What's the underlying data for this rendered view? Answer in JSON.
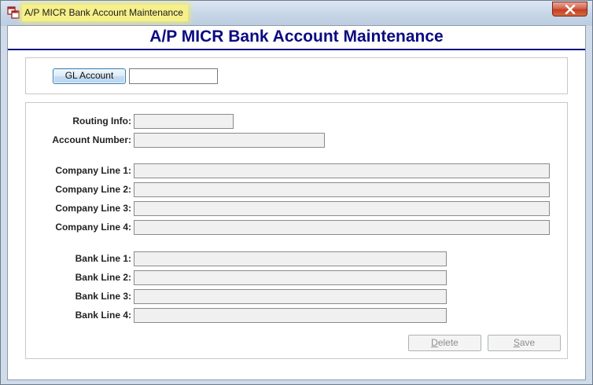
{
  "window": {
    "title": "A/P MICR Bank Account Maintenance",
    "icon": "app-window-icon",
    "close_icon": "close-icon"
  },
  "header": {
    "title": "A/P MICR Bank Account Maintenance"
  },
  "gl": {
    "button_label": "GL Account",
    "value": ""
  },
  "form": {
    "routing_label": "Routing Info:",
    "account_label": "Account Number:",
    "company_lines": [
      "Company Line 1:",
      "Company Line 2:",
      "Company Line 3:",
      "Company Line 4:"
    ],
    "bank_lines": [
      "Bank Line 1:",
      "Bank Line 2:",
      "Bank Line 3:",
      "Bank Line 4:"
    ]
  },
  "actions": {
    "delete_first": "D",
    "delete_rest": "elete",
    "save_first": "S",
    "save_rest": "ave"
  },
  "colors": {
    "title_highlight": "#f6f08a",
    "header_blue": "#0b0b82",
    "field_bg": "#f0f0f0"
  }
}
